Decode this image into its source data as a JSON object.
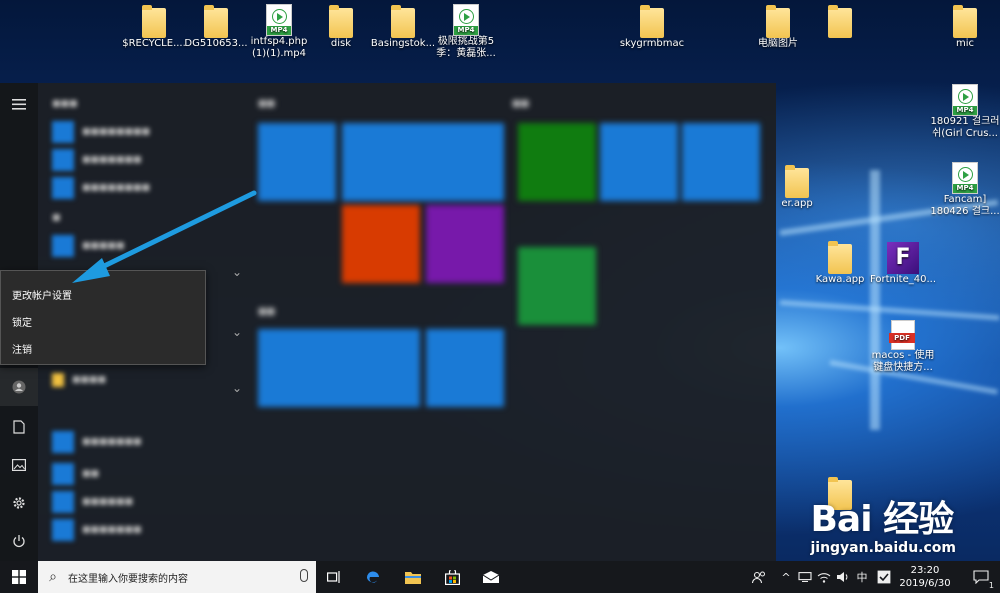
{
  "desktop": {
    "icons": [
      {
        "label": "$RECYCLE....",
        "type": "folder"
      },
      {
        "label": "DG510653...",
        "type": "folder"
      },
      {
        "label": "intfsp4.php (1)(1).mp4",
        "type": "mp4"
      },
      {
        "label": "disk",
        "type": "folder"
      },
      {
        "label": "Basingstok...",
        "type": "folder"
      },
      {
        "label": "极限挑战第5季：黄磊张...",
        "type": "mp4"
      },
      {
        "label": "skygrmbmac",
        "type": "folder"
      },
      {
        "label": "电脑图片",
        "type": "folder"
      },
      {
        "label": "",
        "type": "folder"
      },
      {
        "label": "mic",
        "type": "folder"
      },
      {
        "label": "180921 걸크러쉬(Girl Crus...",
        "type": "mp4"
      },
      {
        "label": "Fancam] 180426 걸크...",
        "type": "mp4"
      },
      {
        "label": "er.app",
        "type": "folder"
      },
      {
        "label": "Kawa.app",
        "type": "folder"
      },
      {
        "label": "Fortnite_40...",
        "type": "fortnite"
      },
      {
        "label": "macos - 使用键盘快捷方...",
        "type": "pdf"
      },
      {
        "label": "",
        "type": "folder"
      }
    ],
    "mp4_tag": "MP4",
    "pdf_tag": "PDF",
    "fortnite_glyph": "F"
  },
  "start_menu": {
    "rail": {
      "menu_icon": "hamburger-icon",
      "user_icon": "user-icon",
      "documents_icon": "document-icon",
      "pictures_icon": "picture-icon",
      "settings_icon": "gear-icon",
      "power_icon": "power-icon"
    },
    "context_menu": {
      "items": [
        "更改帐户设置",
        "锁定",
        "注销"
      ]
    }
  },
  "taskbar": {
    "search_placeholder": "在这里输入你要搜索的内容",
    "time": "23:20",
    "date": "2019/6/30",
    "ime": "中",
    "notification_count": "1"
  },
  "watermark": {
    "logo": "Bai 经验",
    "url": "jingyan.baidu.com"
  },
  "colors": {
    "accent": "#1a7ad6",
    "arrow": "#1e9be0",
    "office": "#d83b01",
    "onenote": "#7719aa",
    "xbox": "#107c10"
  }
}
